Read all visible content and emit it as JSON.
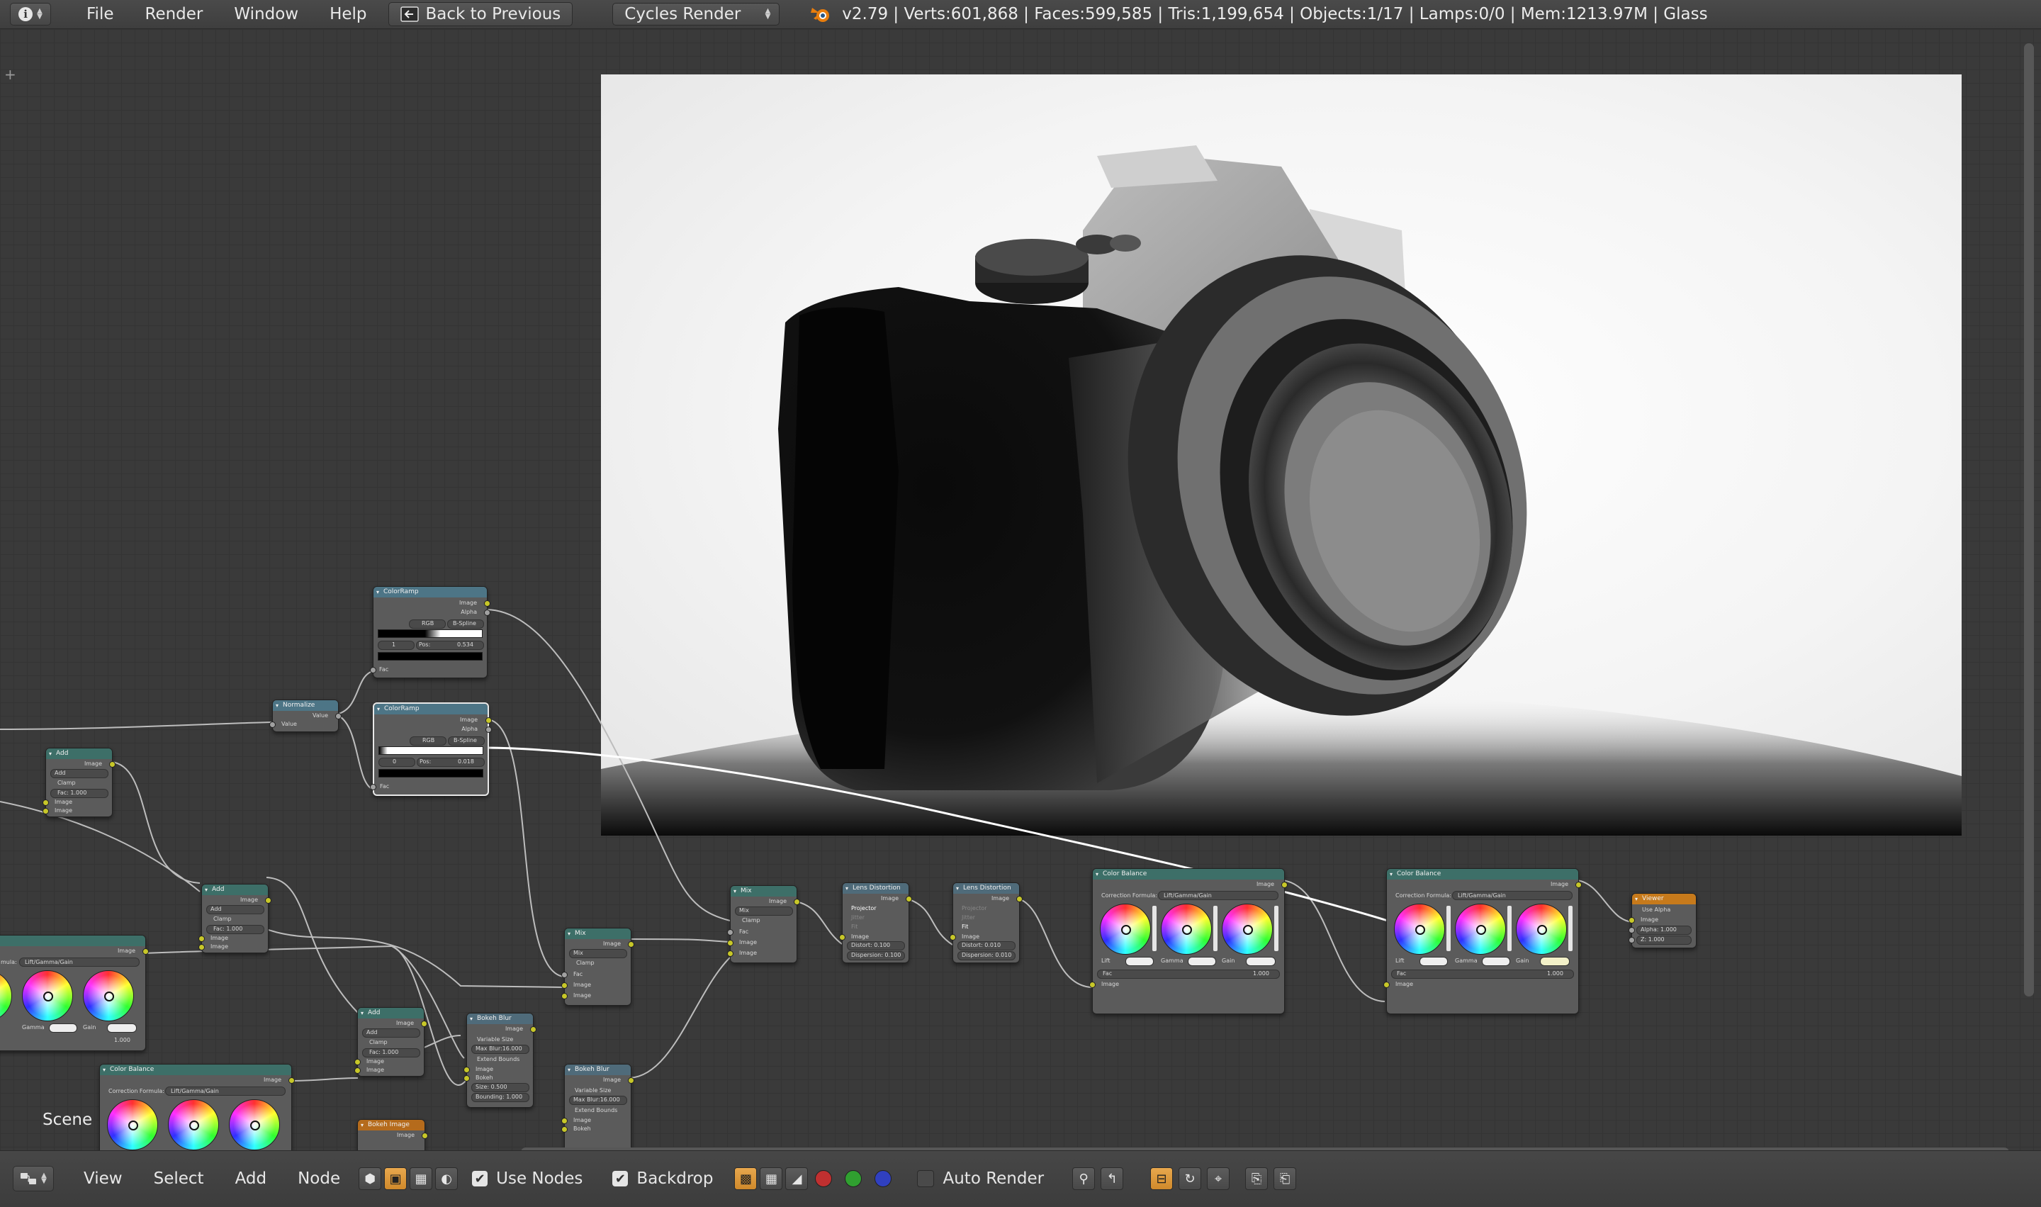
{
  "header": {
    "editor_icon": "info-icon",
    "menus": [
      "File",
      "Render",
      "Window",
      "Help"
    ],
    "back_button": "Back to Previous",
    "render_engine": "Cycles Render",
    "stats": "v2.79 | Verts:601,868 | Faces:599,585 | Tris:1,199,654 | Objects:1/17 | Lamps:0/0 | Mem:1213.97M | Glass"
  },
  "footer": {
    "menus": [
      "View",
      "Select",
      "Add",
      "Node"
    ],
    "use_nodes_label": "Use Nodes",
    "use_nodes_checked": true,
    "backdrop_label": "Backdrop",
    "backdrop_checked": true,
    "auto_render_label": "Auto Render",
    "auto_render_checked": false,
    "channel_colors": [
      "#c03030",
      "#30a030",
      "#3040c0"
    ]
  },
  "scene_label": "Scene",
  "nodes": {
    "colorramp1": {
      "title": "ColorRamp",
      "out1": "Image",
      "out2": "Alpha",
      "mode": "RGB",
      "interp": "B-Spline",
      "pos_label": "Pos:",
      "pos": "0.534",
      "index": "1",
      "in": "Fac"
    },
    "colorramp2": {
      "title": "ColorRamp",
      "out1": "Image",
      "out2": "Alpha",
      "mode": "RGB",
      "interp": "B-Spline",
      "pos_label": "Pos:",
      "pos": "0.018",
      "index": "0",
      "in": "Fac"
    },
    "normalize": {
      "title": "Normalize",
      "out": "Value",
      "in": "Value"
    },
    "add1": {
      "title": "Add",
      "out": "Image",
      "blend": "Add",
      "clamp": "Clamp",
      "fac": "Fac: 1.000",
      "in1": "Image",
      "in2": "Image"
    },
    "add2": {
      "title": "Add",
      "out": "Image",
      "blend": "Add",
      "clamp": "Clamp",
      "fac": "Fac: 1.000",
      "in1": "Image",
      "in2": "Image"
    },
    "add3": {
      "title": "Add",
      "out": "Image",
      "blend": "Add",
      "clamp": "Clamp",
      "fac": "Fac: 1.000",
      "in1": "Image",
      "in2": "Image"
    },
    "mix1": {
      "title": "Mix",
      "out": "Image",
      "blend": "Mix",
      "clamp": "Clamp",
      "fac": "Fac",
      "in1": "Image",
      "in2": "Image"
    },
    "mix2": {
      "title": "Mix",
      "out": "Image",
      "blend": "Mix",
      "clamp": "Clamp",
      "fac": "Fac",
      "in1": "Image",
      "in2": "Image"
    },
    "lens1": {
      "title": "Lens Distortion",
      "out": "Image",
      "opt1": "Projector",
      "opt2": "Jitter",
      "opt3": "Fit",
      "in": "Image",
      "distort": "Distort: 0.100",
      "dispersion": "Dispersion: 0.100"
    },
    "lens2": {
      "title": "Lens Distortion",
      "out": "Image",
      "opt1": "Projector",
      "opt2": "Jitter",
      "opt3": "Fit",
      "in": "Image",
      "distort": "Distort: 0.010",
      "dispersion": "Dispersion: 0.010"
    },
    "colorbal1": {
      "title": "Color Balance",
      "out": "Image",
      "formula_label": "Correction Formula:",
      "formula": "Lift/Gamma/Gain",
      "lift": "Lift",
      "gamma": "Gamma",
      "gain": "Gain",
      "fac": "Fac",
      "fac_val": "1.000",
      "in": "Image"
    },
    "colorbal2": {
      "title": "Color Balance",
      "out": "Image",
      "formula_label": "Correction Formula:",
      "formula": "Lift/Gamma/Gain",
      "lift": "Lift",
      "gamma": "Gamma",
      "gain": "Gain",
      "fac": "Fac",
      "fac_val": "1.000",
      "in": "Image"
    },
    "colorbal3": {
      "title": "",
      "out": "Image",
      "formula_label": "mula:",
      "formula": "Lift/Gamma/Gain",
      "gamma": "Gamma",
      "gain": "Gain",
      "fac_val": "1.000"
    },
    "colorbal4": {
      "title": "Color Balance",
      "out": "Image",
      "formula_label": "Correction Formula:",
      "formula": "Lift/Gamma/Gain"
    },
    "viewer": {
      "title": "Viewer",
      "use_alpha": "Use Alpha",
      "in": "Image",
      "alpha": "Alpha: 1.000",
      "z": "Z: 1.000"
    },
    "bokehblur1": {
      "title": "Bokeh Blur",
      "out": "Image",
      "opt1": "Variable Size",
      "max_blur": "Max Blur:16.000",
      "opt2": "Extend Bounds",
      "in1": "Image",
      "in2": "Bokeh",
      "size": "Size: 0.500",
      "bounding": "Bounding: 1.000"
    },
    "bokehblur2": {
      "title": "Bokeh Blur",
      "out": "Image",
      "opt1": "Variable Size",
      "max_blur": "Max Blur:16.000",
      "opt2": "Extend Bounds",
      "in1": "Image",
      "in2": "Bokeh"
    },
    "bokehimage": {
      "title": "Bokeh Image",
      "out": "Image"
    }
  }
}
